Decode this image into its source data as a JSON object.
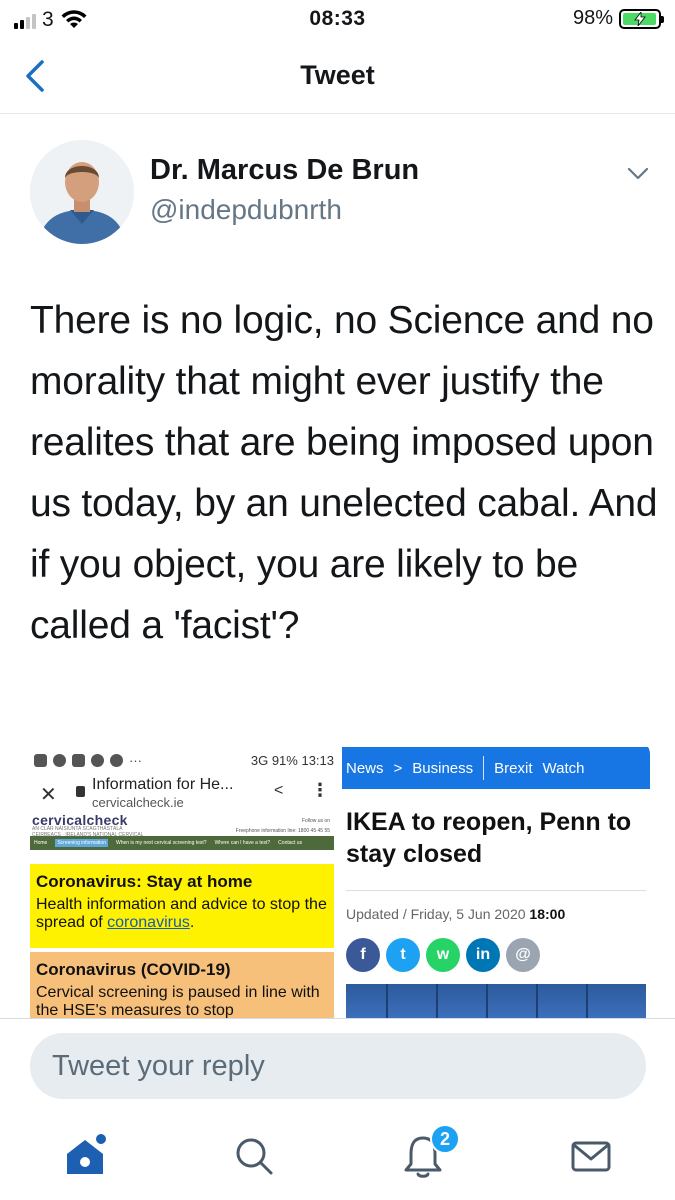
{
  "status_bar": {
    "carrier": "3",
    "time": "08:33",
    "battery_percent": "98%",
    "battery_level": 0.98,
    "battery_charging": true
  },
  "nav": {
    "title": "Tweet",
    "back_icon": "chevron-left-icon"
  },
  "tweet": {
    "author_name": "Dr. Marcus De Brun",
    "author_handle": "@indepdubnrth",
    "text": "There is no logic, no Science and no morality that might ever justify the realites that are being imposed upon us today, by an unelected cabal. And if you object, you are likely to be called a 'facist'?",
    "menu_icon": "chevron-down-icon"
  },
  "media_left": {
    "status_text": "3G 91% 13:13",
    "page_title": "Information for He...",
    "domain": "cervicalcheck.ie",
    "site_logo": "cervicalcheck",
    "site_sub": "AN CLÁR NÁISIÚNTA SCAGTHÁSTÁLA CEIRBEACS · IRELAND'S NATIONAL CERVICAL SCREENING PROGRAMME",
    "follow": "Follow us on",
    "freephone": "Freephone information line: 1800 45 45 55",
    "nav_items": [
      "Home",
      "Screening information",
      "When is my next cervical screening test?",
      "Where can I have a test?",
      "Contact us"
    ],
    "box1_heading": "Coronavirus: Stay at home",
    "box1_text_before": "Health information and advice to stop the spread of ",
    "box1_link": "coronavirus",
    "box1_text_after": ".",
    "box2_heading": "Coronavirus (COVID-19)",
    "box2_text": "Cervical screening is paused in line with the HSE's measures to stop"
  },
  "media_right": {
    "nav_news": "News",
    "nav_arrow": ">",
    "nav_business": "Business",
    "nav_brexit": "Brexit",
    "nav_watch": "Watch",
    "headline": "IKEA to reopen, Penn to stay closed",
    "updated_prefix": "Updated / Friday, 5 Jun 2020 ",
    "updated_time": "18:00",
    "share_buttons": [
      {
        "label": "f",
        "color": "#3b5998"
      },
      {
        "label": "t",
        "color": "#1da1f2"
      },
      {
        "label": "w",
        "color": "#25d366"
      },
      {
        "label": "in",
        "color": "#0077b5"
      },
      {
        "label": "@",
        "color": "#9aa5b1"
      }
    ]
  },
  "reply": {
    "placeholder": "Tweet your reply"
  },
  "tabbar": {
    "notifications_badge": "2",
    "active_color": "#1d5fb0",
    "inactive_color": "#4a5a6a"
  }
}
